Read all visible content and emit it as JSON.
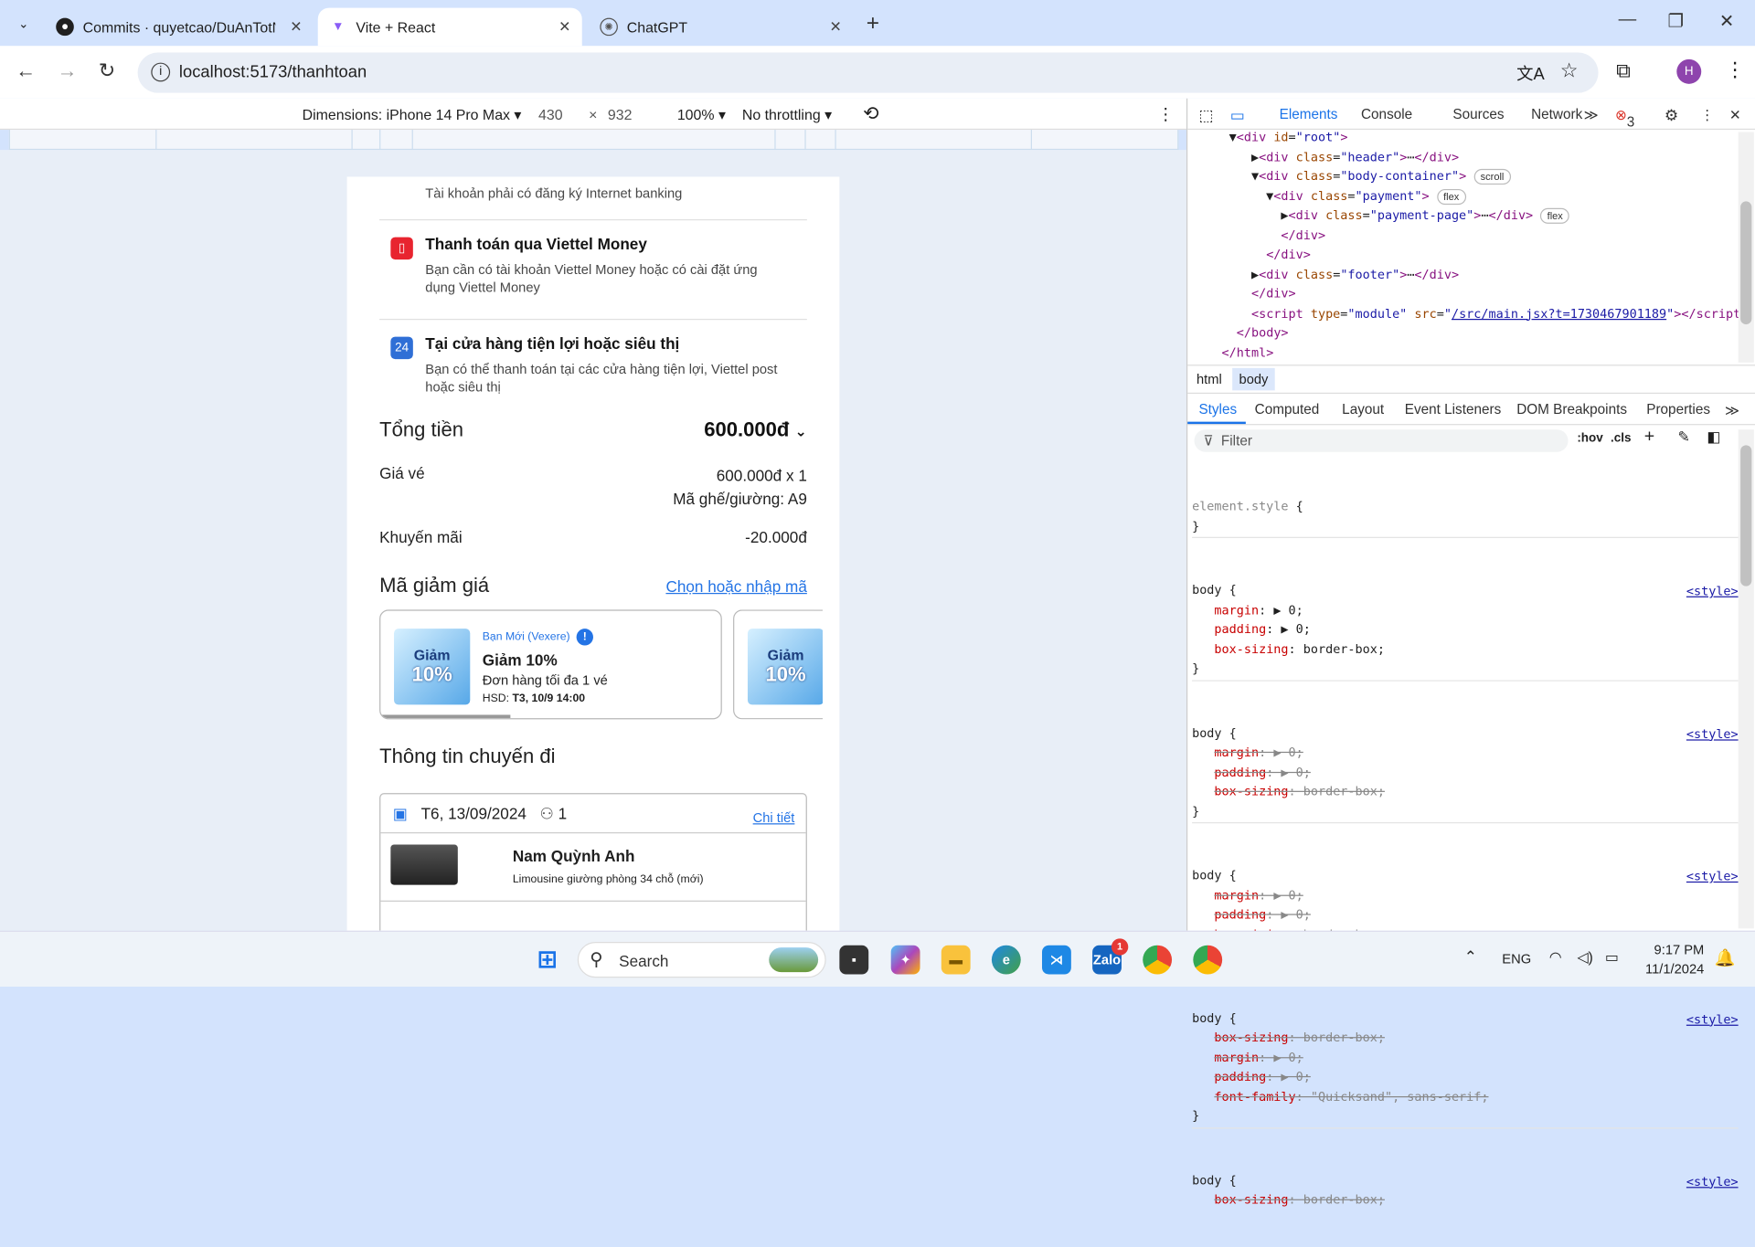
{
  "tabs": [
    {
      "title": "Commits · quyetcao/DuAnTotN",
      "icon": "github-icon"
    },
    {
      "title": "Vite + React",
      "icon": "vite-icon"
    },
    {
      "title": "ChatGPT",
      "icon": "chatgpt-icon"
    }
  ],
  "address": {
    "url": "localhost:5173/thanhtoan"
  },
  "device_toolbar": {
    "dimensions_label": "Dimensions: iPhone 14 Pro Max",
    "width": "430",
    "times": "×",
    "height": "932",
    "zoom": "100%",
    "throttling": "No throttling"
  },
  "page": {
    "internet_banking_note": "Tài khoản phải có đăng ký Internet banking",
    "methods": [
      {
        "title": "Thanh toán qua Viettel Money",
        "desc": "Bạn cần có tài khoản Viettel Money hoặc có cài đặt ứng dụng Viettel Money",
        "color": "#e8242f"
      },
      {
        "title": "Tại cửa hàng tiện lợi hoặc siêu thị",
        "desc": "Bạn có thể thanh toán tại các cửa hàng tiện lợi, Viettel post hoặc siêu thị",
        "color": "#2f6fd6"
      }
    ],
    "total_label": "Tổng tiền",
    "total_value": "600.000đ",
    "ticket_label": "Giá vé",
    "ticket_value": "600.000đ x 1",
    "seat_value": "Mã ghế/giường: A9",
    "promo_label": "Khuyến mãi",
    "promo_value": "-20.000đ",
    "discount_label": "Mã giảm giá",
    "discount_link": "Chọn hoặc nhập mã",
    "voucher": {
      "tag": "Bạn Mới (Vexere)",
      "title": "Giảm 10%",
      "desc": "Đơn hàng tối đa 1 vé",
      "expiry_label": "HSD:",
      "expiry_value": "T3, 10/9 14:00",
      "img_top": "Giảm",
      "img_pct": "10%"
    },
    "trip_heading": "Thông tin chuyến đi",
    "trip": {
      "date": "T6, 13/09/2024",
      "passengers": "1",
      "detail_link": "Chi tiết",
      "operator": "Nam Quỳnh Anh",
      "vehicle": "Limousine giường phòng 34 chỗ (mới)"
    }
  },
  "devtools": {
    "tabs": [
      "Elements",
      "Console",
      "Sources",
      "Network"
    ],
    "error_count": "3",
    "breadcrumbs": [
      "html",
      "body"
    ],
    "style_tabs": [
      "Styles",
      "Computed",
      "Layout",
      "Event Listeners",
      "DOM Breakpoints",
      "Properties"
    ],
    "filter_placeholder": "Filter",
    "hov": ":hov",
    "cls": ".cls",
    "script_src": "/src/main.jsx?t=1730467901189",
    "style_source": "<style>"
  },
  "taskbar": {
    "search_placeholder": "Search",
    "lang": "ENG",
    "time": "9:17 PM",
    "date": "11/1/2024",
    "zalo_badge": "1"
  }
}
